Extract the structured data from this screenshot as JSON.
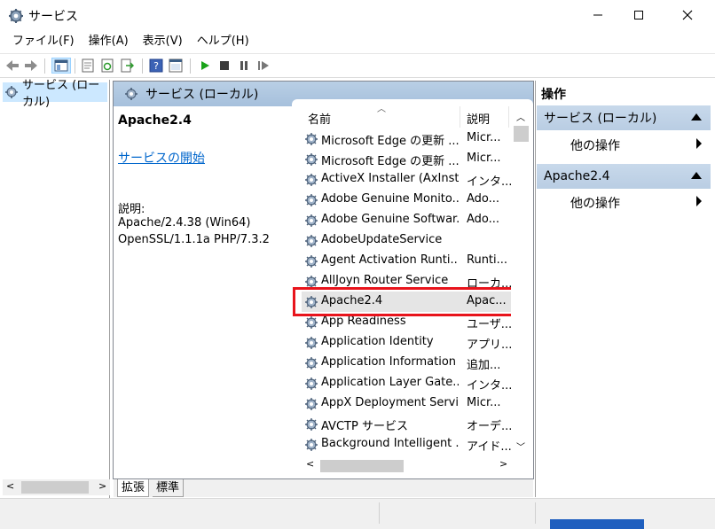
{
  "window": {
    "title": "サービス",
    "controls": [
      "minimize-icon",
      "maximize-icon",
      "close-icon"
    ]
  },
  "menu": [
    "ファイル(F)",
    "操作(A)",
    "表示(V)",
    "ヘルプ(H)"
  ],
  "toolbar": {
    "icons": [
      "back-icon",
      "forward-icon",
      "show-tree-icon",
      "properties-icon",
      "refresh-icon",
      "export-icon",
      "help-icon",
      "console-icon",
      "play-icon",
      "stop-icon",
      "pause-icon",
      "restart-icon"
    ]
  },
  "tree": {
    "root": "サービス (ローカル)"
  },
  "center": {
    "header": "サービス (ローカル)",
    "detail": {
      "service_name": "Apache2.4",
      "start_link": "サービスの開始",
      "desc_label": "説明:",
      "desc_line1": "Apache/2.4.38 (Win64)",
      "desc_line2": "OpenSSL/1.1.1a PHP/7.3.2"
    },
    "columns": {
      "name": "名前",
      "desc": "説明"
    },
    "rows": [
      {
        "name": "Microsoft Edge の更新 ...",
        "desc": "Micr..."
      },
      {
        "name": "Microsoft Edge の更新 ...",
        "desc": "Micr..."
      },
      {
        "name": "ActiveX Installer (AxInst...",
        "desc": "インタ..."
      },
      {
        "name": "Adobe Genuine Monito...",
        "desc": "Ado..."
      },
      {
        "name": "Adobe Genuine Softwar...",
        "desc": "Ado..."
      },
      {
        "name": "AdobeUpdateService",
        "desc": ""
      },
      {
        "name": "Agent Activation Runti...",
        "desc": "Runti..."
      },
      {
        "name": "AllJoyn Router Service",
        "desc": "ローカ..."
      },
      {
        "name": "Apache2.4",
        "desc": "Apac..."
      },
      {
        "name": "App Readiness",
        "desc": "ユーザ..."
      },
      {
        "name": "Application Identity",
        "desc": "アプリ..."
      },
      {
        "name": "Application Information",
        "desc": "追加..."
      },
      {
        "name": "Application Layer Gate...",
        "desc": "インタ..."
      },
      {
        "name": "AppX Deployment Servi...",
        "desc": "Micr..."
      },
      {
        "name": "AVCTP サービス",
        "desc": "オーデ..."
      },
      {
        "name": "Background Intelligent ...",
        "desc": "アイド..."
      }
    ],
    "tabs": [
      "拡張",
      "標準"
    ]
  },
  "actions": {
    "title": "操作",
    "sections": [
      {
        "label": "サービス (ローカル)",
        "item": "他の操作"
      },
      {
        "label": "Apache2.4",
        "item": "他の操作"
      }
    ]
  }
}
